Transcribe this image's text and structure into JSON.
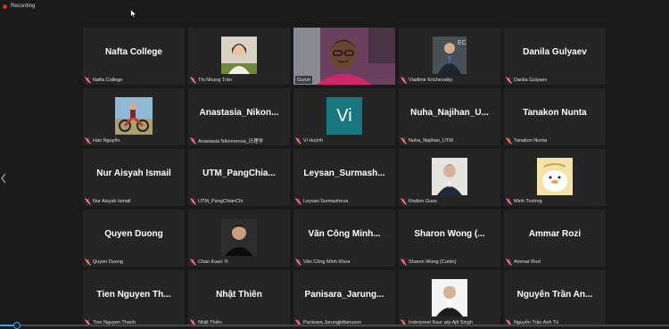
{
  "recording": {
    "label": "Recording"
  },
  "participants": [
    {
      "display": "Nafta College",
      "footer": "Nafta College",
      "kind": "name"
    },
    {
      "footer": "Thị Nhung Trần",
      "kind": "photo",
      "avatar": "woman-avatar"
    },
    {
      "footer": "Guruh",
      "kind": "video",
      "active": true
    },
    {
      "footer": "Vladimir Krichevskiy",
      "kind": "photo",
      "avatar": "man-suit-avatar"
    },
    {
      "display": "Danila Gulyaev",
      "footer": "Danila Gulyaev",
      "kind": "name"
    },
    {
      "footer": "Hào Nguyễn",
      "kind": "photo",
      "avatar": "motorbike-photo"
    },
    {
      "display": "Anastasia_Nikon...",
      "footer": "Anastasia Nikonorova_日理学",
      "kind": "name"
    },
    {
      "footer": "Vi Huỳnh",
      "kind": "initials",
      "initials": "Vi"
    },
    {
      "display": "Nuha_Najihan_U...",
      "footer": "Nuha_Najihan_UTM",
      "kind": "name"
    },
    {
      "display": "Tanakon Nunta",
      "footer": "Tanakon Nunta",
      "kind": "name"
    },
    {
      "display": "Nur Aisyah Ismail",
      "footer": "Nur Aisyah Ismail",
      "kind": "name"
    },
    {
      "display": "UTM_PangChia...",
      "footer": "UTM_PangChianChi",
      "kind": "name"
    },
    {
      "display": "Leysan_Surmash...",
      "footer": "Leysan Surmasheva",
      "kind": "name"
    },
    {
      "footer": "Rodion Guss",
      "kind": "photo",
      "avatar": "man-avatar"
    },
    {
      "footer": "Minh Trường",
      "kind": "photo",
      "avatar": "cartoon-duck-avatar"
    },
    {
      "display": "Quyen Duong",
      "footer": "Quyen Duong",
      "kind": "name"
    },
    {
      "footer": "Chan Kuan Yi",
      "kind": "photo",
      "avatar": "man-dark-avatar"
    },
    {
      "display": "Văn Công Minh...",
      "footer": "Văn Công Minh Khoa",
      "kind": "name"
    },
    {
      "display": "Sharon Wong (...",
      "footer": "Sharon Wong (Curtin)",
      "kind": "name"
    },
    {
      "display": "Ammar Rozi",
      "footer": "Ammar Rozi",
      "kind": "name"
    },
    {
      "display": "Tien Nguyen Th...",
      "footer": "Tien Nguyen Thanh",
      "kind": "name"
    },
    {
      "display": "Nhật Thiên",
      "footer": "Nhật Thiên",
      "kind": "name"
    },
    {
      "display": "Panisara_Jarung...",
      "footer": "Panisara Jarungjidtanuson",
      "kind": "name"
    },
    {
      "footer": "Inderpreet Kaur a/p Ajit Singh",
      "kind": "photo",
      "avatar": "man-shirt-avatar"
    },
    {
      "display": "Nguyễn Trần An...",
      "footer": "Nguyễn Trần Anh Tú",
      "kind": "name"
    }
  ],
  "colors": {
    "active_border": "#c8e64a",
    "muted_mic": "#e02828",
    "tile_bg": "#252525",
    "progress": "#3aa0ff"
  },
  "icons": {
    "muted": "mic-muted-icon",
    "record": "record-dot-icon",
    "cursor": "mouse-cursor-icon",
    "nav_left": "chevron-left-icon"
  },
  "playback": {
    "progress": 0.02
  }
}
